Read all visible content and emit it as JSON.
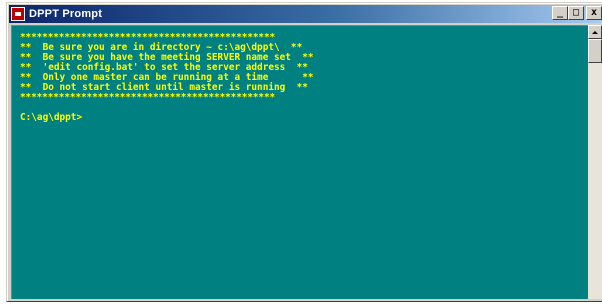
{
  "window": {
    "title": "DPPT Prompt",
    "buttons": {
      "minimize": "_",
      "maximize": "□",
      "close": "x"
    }
  },
  "console": {
    "lines": [
      "**********************************************",
      "**  Be sure you are in directory ~ c:\\ag\\dppt\\  **",
      "**  Be sure you have the meeting SERVER name set  **",
      "**  'edit config.bat' to set the server address  **",
      "**  Only one master can be running at a time      **",
      "**  Do not start client until master is running  **",
      "**********************************************"
    ],
    "prompt": "C:\\ag\\dppt>",
    "text_color": "#ffff00",
    "background": "#008080"
  }
}
